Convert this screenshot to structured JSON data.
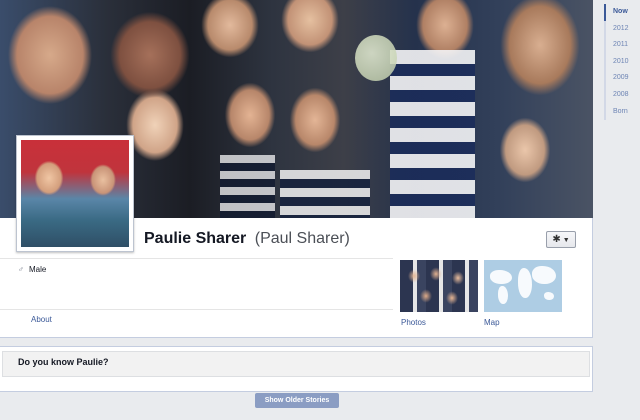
{
  "profile": {
    "name": "Paulie Sharer",
    "alternate_name": "(Paul Sharer)",
    "gender": "Male",
    "gender_icon": "male-symbol-icon",
    "settings_icon": "gear-icon"
  },
  "sections": {
    "about": "About",
    "photos": "Photos",
    "map": "Map"
  },
  "prompt": {
    "title": "Do you know Paulie?"
  },
  "buttons": {
    "show_older_stories": "Show Older Stories"
  },
  "scrubber": {
    "items": [
      {
        "label": "Now"
      },
      {
        "label": "2012"
      },
      {
        "label": "2011"
      },
      {
        "label": "2010"
      },
      {
        "label": "2009"
      },
      {
        "label": "2008"
      },
      {
        "label": "Born"
      }
    ]
  },
  "colors": {
    "link": "#3b5998",
    "scrubber_link": "#6d84b4",
    "button": "#8b9dc3"
  }
}
